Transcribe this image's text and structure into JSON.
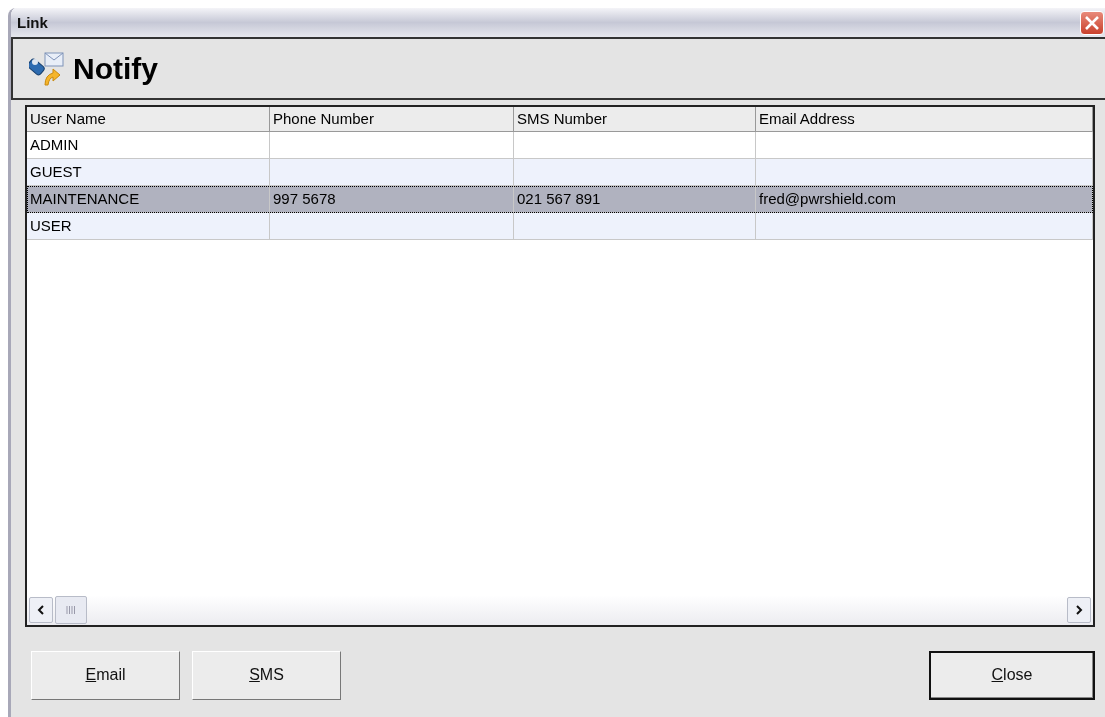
{
  "window": {
    "title": "Link"
  },
  "header": {
    "title": "Notify"
  },
  "table": {
    "columns": [
      "User Name",
      "Phone Number",
      "SMS Number",
      "Email Address"
    ],
    "rows": [
      {
        "cells": [
          "ADMIN",
          "",
          "",
          ""
        ],
        "selected": false
      },
      {
        "cells": [
          "GUEST",
          "",
          "",
          ""
        ],
        "selected": false
      },
      {
        "cells": [
          "MAINTENANCE",
          "997 5678",
          "021 567 891",
          "fred@pwrshield.com"
        ],
        "selected": true
      },
      {
        "cells": [
          "USER",
          "",
          "",
          ""
        ],
        "selected": false
      }
    ]
  },
  "buttons": [
    {
      "label": "Email",
      "default": false,
      "kind": "send"
    },
    {
      "label": "SMS",
      "default": false,
      "kind": "send"
    },
    {
      "label": "Close",
      "default": true,
      "kind": "close"
    }
  ]
}
